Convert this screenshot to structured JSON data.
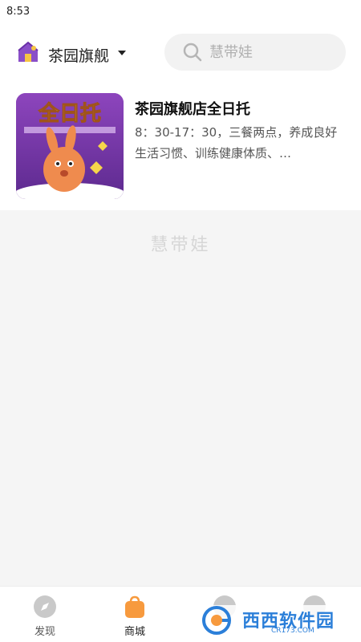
{
  "status_bar": {
    "time": "8:53"
  },
  "header": {
    "store_name": "茶园旗舰",
    "search_placeholder": "慧带娃"
  },
  "product": {
    "title": "茶园旗舰店全日托",
    "description": "8：30-17：30，三餐两点，养成良好生活习惯、训练健康体质、…",
    "thumbnail_title": "全日托"
  },
  "main": {
    "watermark_logo": "慧带娃"
  },
  "tabbar": {
    "tabs": [
      {
        "label": "发现",
        "icon": "compass-icon"
      },
      {
        "label": "商城",
        "icon": "shopping-bag-icon"
      },
      {
        "label": "",
        "icon": "schedule-icon"
      },
      {
        "label": "",
        "icon": "profile-icon"
      }
    ]
  },
  "watermark": {
    "text": "西西软件园",
    "sub": "CR173.COM"
  },
  "colors": {
    "accent": "#f79a3e",
    "brand_purple": "#7b3fa8",
    "watermark_blue": "#2b7fd9"
  }
}
